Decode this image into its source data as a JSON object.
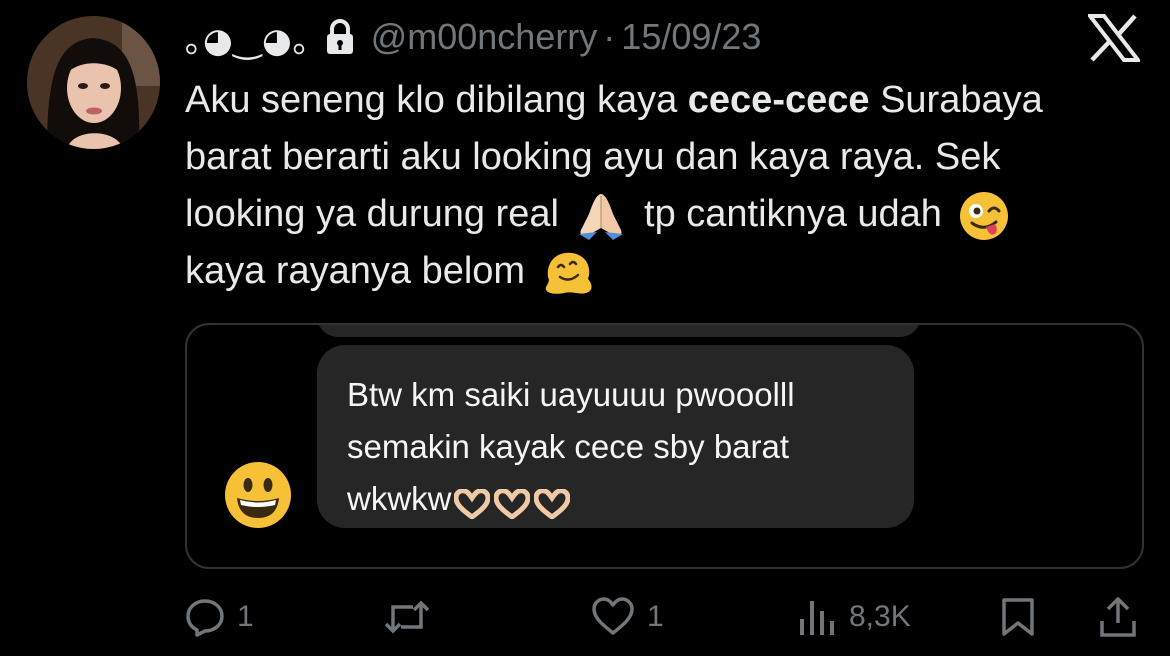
{
  "tweet": {
    "display_name": "｡◕‿◕｡",
    "handle": "@m00ncherry",
    "separator": "·",
    "date": "15/09/23",
    "text_part1": "Aku seneng klo dibilang kaya ",
    "text_bold": "cece-cece",
    "text_part2": " Surabaya barat berarti aku looking ayu dan kaya raya. Sek looking ya durung real ",
    "text_part3": " tp cantiknya udah ",
    "text_part4": " kaya rayanya belom "
  },
  "media": {
    "dm_line1": "Btw km saiki uayuuuu pwooolll",
    "dm_line2": "semakin kayak cece sby barat",
    "dm_line3": "wkwkw"
  },
  "actions": {
    "reply_count": "1",
    "repost_count": "",
    "like_count": "1",
    "views_count": "8,3K"
  },
  "icons": {
    "lock": "lock-icon",
    "logo": "x-logo-icon",
    "reply": "reply-icon",
    "repost": "repost-icon",
    "like": "heart-icon",
    "views": "views-icon",
    "bookmark": "bookmark-icon",
    "share": "share-icon"
  },
  "colors": {
    "background": "#000000",
    "text": "#e7e9ea",
    "secondary": "#71767b",
    "bubble": "#262626"
  }
}
